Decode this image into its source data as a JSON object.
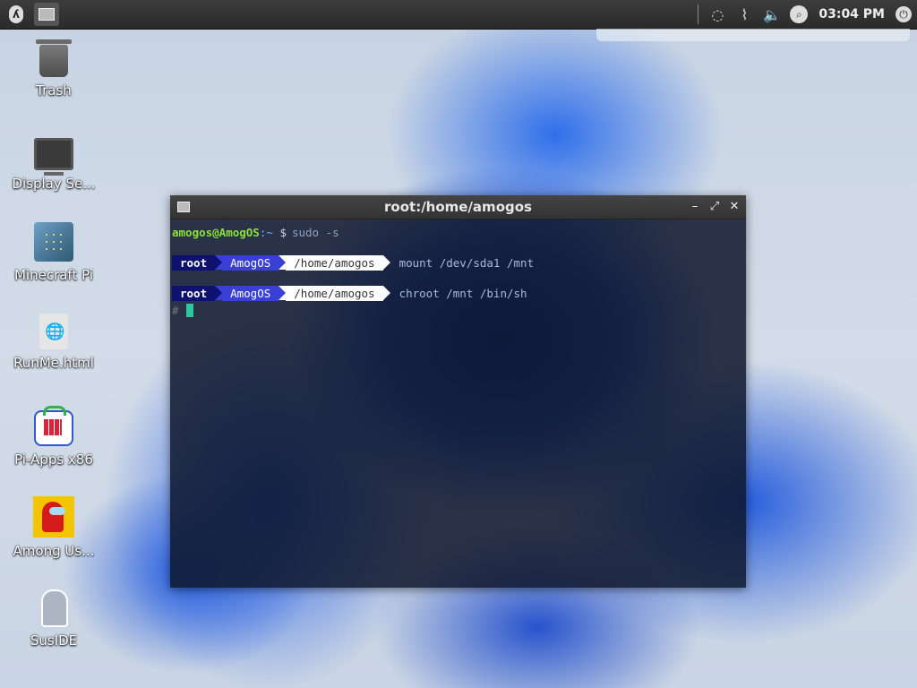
{
  "panel": {
    "clock": "03:04 PM"
  },
  "desktop": {
    "icons": [
      {
        "label": "Trash"
      },
      {
        "label": "Display Se..."
      },
      {
        "label": "Minecraft Pi"
      },
      {
        "label": "RunMe.html"
      },
      {
        "label": "Pi-Apps x86"
      },
      {
        "label": "Among Us..."
      },
      {
        "label": "SusIDE"
      }
    ]
  },
  "terminal": {
    "title": "root:/home/amogos",
    "line1": {
      "user_host": "amogos@AmogOS",
      "path": ":~",
      "prompt": "$",
      "command": "sudo -s"
    },
    "prompt_segments": {
      "user": "root",
      "host": "AmogOS",
      "dir": "/home/amogos"
    },
    "commands": [
      "mount /dev/sda1 /mnt",
      "chroot /mnt /bin/sh"
    ],
    "shell_prompt": "#"
  },
  "colors": {
    "segment_root": "#0e1170",
    "segment_host": "#3a3fd6",
    "segment_dir": "#ffffff",
    "cursor": "#2ec7a0",
    "user_green": "#8ae234"
  }
}
